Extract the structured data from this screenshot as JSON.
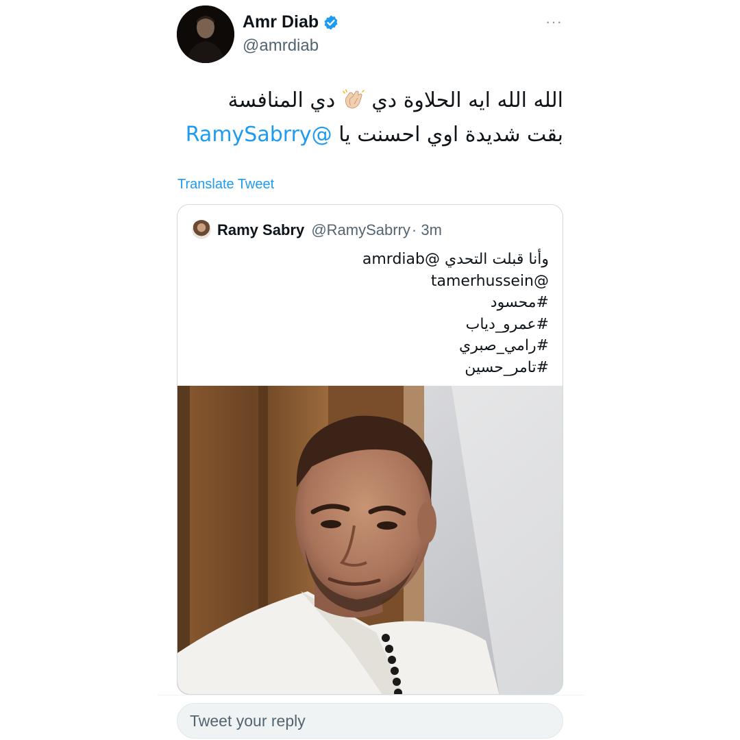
{
  "author": {
    "name": "Amr Diab",
    "handle": "@amrdiab",
    "verified": true,
    "avatar_icon": "profile-photo"
  },
  "more_icon": "ellipsis-icon",
  "tweet": {
    "line1": "الله الله ايه الحلاوة دي",
    "emoji": "clapping-hands-icon",
    "line1_end": "دي المنافسة",
    "line2": "بقت شديدة اوي احسنت يا",
    "mention": "@RamySabrry"
  },
  "translate_label": "Translate Tweet",
  "quoted_tweet": {
    "name": "Ramy Sabry",
    "handle": "@RamySabrry",
    "time": "· 3m",
    "lines": [
      "وأنا قبلت التحدي @amrdiab",
      "@tamerhussein",
      "#محسود",
      "#عمرو_دياب",
      "#رامي_صبري",
      "#تامر_حسين"
    ],
    "image": "photo of a man in a white shirt looking sideways"
  },
  "reply_placeholder": "Tweet your reply",
  "colors": {
    "link": "#1d9bf0",
    "secondary_text": "#536471",
    "border": "#cfd9de",
    "reply_bg": "#eff3f4"
  }
}
